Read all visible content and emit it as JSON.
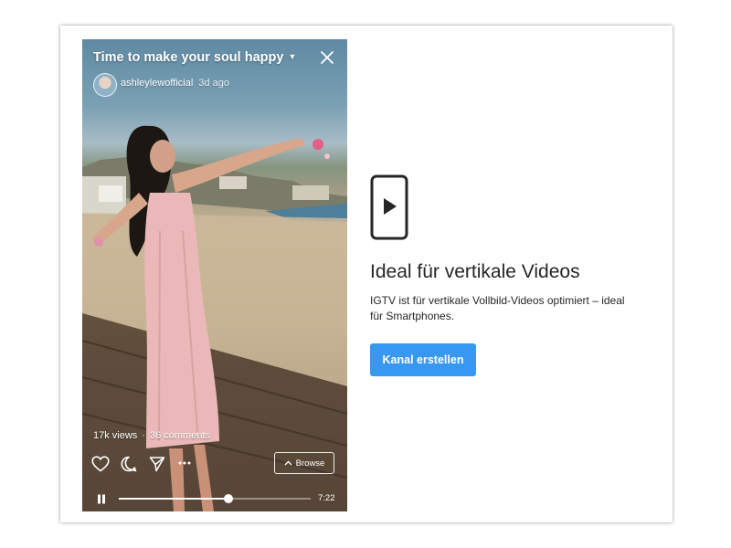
{
  "video": {
    "title": "Time to make your soul happy",
    "username": "ashleylewofficial",
    "posted_ago": "3d ago",
    "views": "17k views",
    "separator": "·",
    "comments": "36 comments",
    "browse_label": "Browse",
    "duration": "7:22",
    "progress": 0.57
  },
  "info": {
    "heading": "Ideal für vertikale Videos",
    "description": "IGTV ist für vertikale Vollbild-Videos optimiert – ideal für Smartphones.",
    "button_label": "Kanal erstellen"
  },
  "colors": {
    "accent": "#3897f0",
    "text": "#262626"
  },
  "icons": [
    "caret-down-icon",
    "close-icon",
    "heart-icon",
    "comment-icon",
    "send-icon",
    "more-icon",
    "chevron-up-icon",
    "pause-icon",
    "phone-play-icon"
  ]
}
